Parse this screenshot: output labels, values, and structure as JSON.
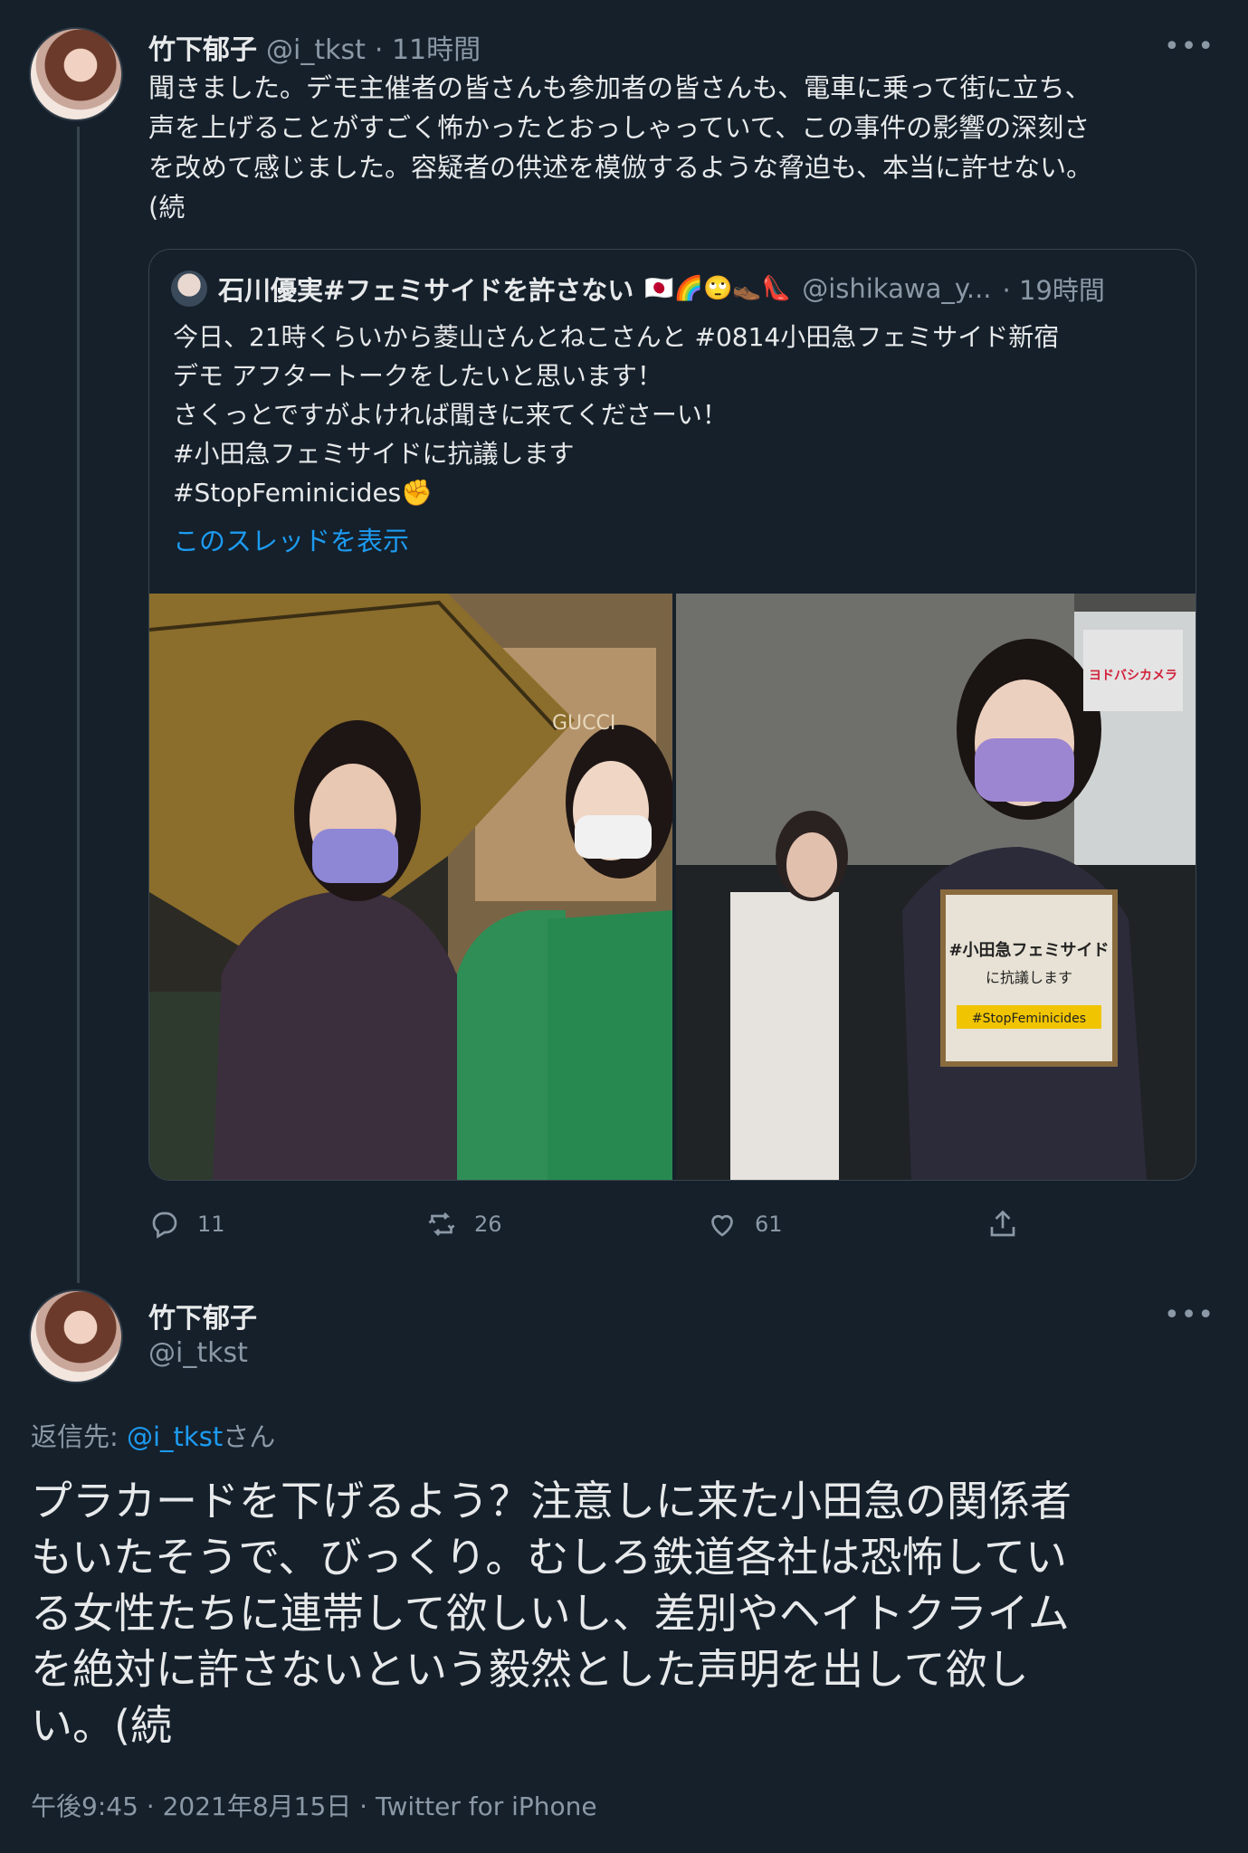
{
  "tweet1": {
    "author_name": "竹下郁子",
    "author_handle": "@i_tkst",
    "time": "· 11時間",
    "more": "•••",
    "text": "聞きました。デモ主催者の皆さんも参加者の皆さんも、電車に乗って街に立ち、\n声を上げることがすごく怖かったとおっしゃっていて、この事件の影響の深刻さ\nを改めて感じました。容疑者の供述を模倣するような脅迫も、本当に許せない。\n(続",
    "quote": {
      "author_name": "石川優実#フェミサイドを許さない",
      "author_emoji": "🇯🇵🌈🙄👞👠",
      "author_handle": "@ishikawa_y...",
      "time": "· 19時間",
      "text": "今日、21時くらいから菱山さんとねこさんと #0814小田急フェミサイド新宿\nデモ アフタートークをしたいと思います！\nさくっとですがよければ聞きに来てくださーい！\n#小田急フェミサイドに抗議します\n#StopFeminicides",
      "hashtag_emoji": "✊",
      "show_thread": "このスレッドを表示",
      "photo_left_sign": "GUCCI",
      "photo_right_sign_line1": "#小田急フェミサイド",
      "photo_right_sign_line2": "に抗議します",
      "photo_right_sign_tag": "#StopFeminicides",
      "photo_right_store": "ヨドバシカメラ"
    },
    "actions": {
      "reply_count": "11",
      "retweet_count": "26",
      "like_count": "61"
    }
  },
  "tweet2": {
    "author_name": "竹下郁子",
    "author_handle": "@i_tkst",
    "more": "•••",
    "reply_prefix": "返信先: ",
    "reply_to": "@i_tkst",
    "reply_suffix": "さん",
    "text": "プラカードを下げるよう？注意しに来た小田急の関係者\nもいたそうで、びっくり。むしろ鉄道各社は恐怖してい\nる女性たちに連帯して欲しいし、差別やヘイトクライム\nを絶対に許さないという毅然とした声明を出して欲し\nい。(続",
    "meta": "午後9:45 · 2021年8月15日 · Twitter for iPhone"
  },
  "colors": {
    "background": "#15202b",
    "link": "#1d9bf0",
    "muted": "#8b98a5"
  }
}
